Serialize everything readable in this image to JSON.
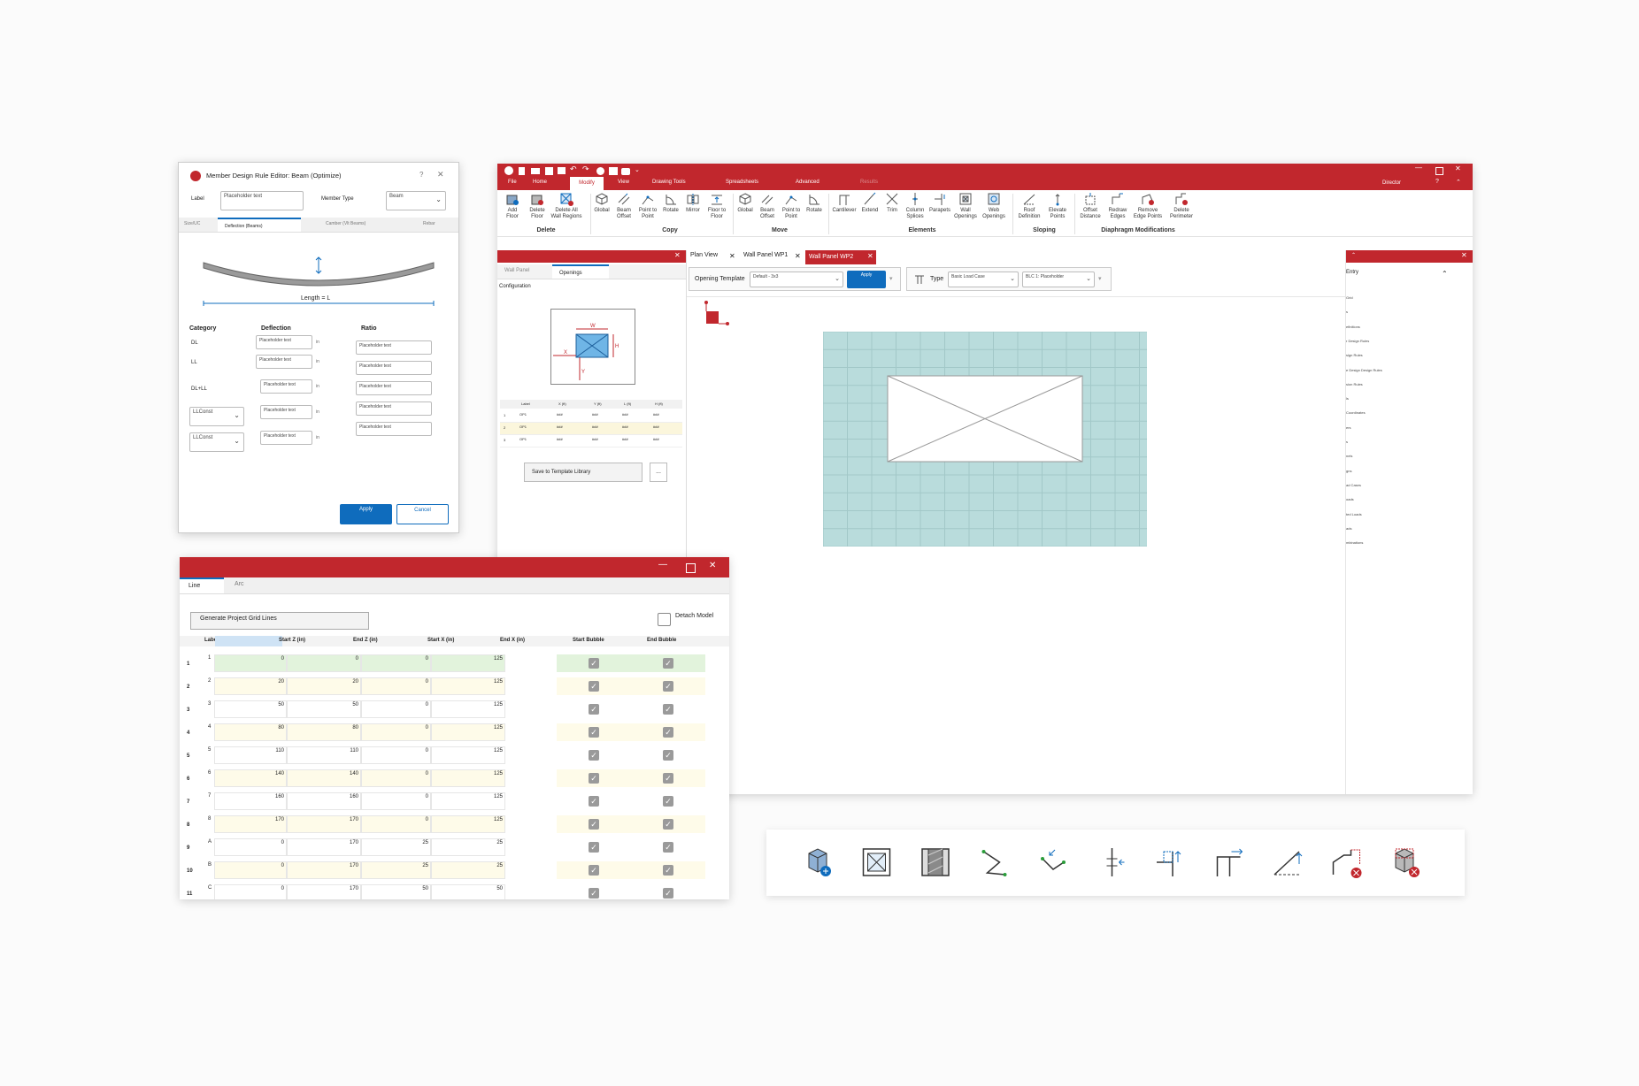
{
  "rule_editor": {
    "title": "Member Design Rule Editor: Beam (Optimize)",
    "help": "?",
    "close": "✕",
    "label_caption": "Label",
    "label_value": "Placeholder text",
    "member_type_caption": "Member Type",
    "member_type_value": "Beam",
    "tabs": [
      "Size/UC",
      "Deflection (Beams)",
      "Camber (Vlt Beams)",
      "Rebar"
    ],
    "length_label": "Length = L",
    "headers": {
      "category": "Category",
      "deflection": "Deflection",
      "ratio": "Ratio"
    },
    "rows": [
      "DL",
      "LL",
      "DL+LL"
    ],
    "combo_values": [
      "LLConst",
      "LLConst"
    ],
    "placeholder": "Placeholder text",
    "unit": "in",
    "apply": "Apply",
    "cancel": "Cancel"
  },
  "main": {
    "account": "Director",
    "menu": [
      "File",
      "Home",
      "Modify",
      "View",
      "Drawing Tools",
      "Spreadsheets",
      "Advanced",
      "Results"
    ],
    "ribbon": {
      "delete": {
        "label": "Delete",
        "items": [
          "Add\nFloor",
          "Delete\nFloor",
          "Delete All\nWall Regions"
        ]
      },
      "copy": {
        "label": "Copy",
        "items": [
          "Global",
          "Beam\nOffset",
          "Point to\nPoint",
          "Rotate",
          "Mirror",
          "Floor to\nFloor"
        ]
      },
      "move": {
        "label": "Move",
        "items": [
          "Global",
          "Beam\nOffset",
          "Point to\nPoint",
          "Rotate"
        ]
      },
      "elements": {
        "label": "Elements",
        "items": [
          "Cantilever",
          "Extend",
          "Trim",
          "Column\nSplices",
          "Parapets",
          "Wall\nOpenings",
          "Web\nOpenings"
        ]
      },
      "sloping": {
        "label": "Sloping",
        "items": [
          "Roof\nDefinition",
          "Elevate\nPoints"
        ]
      },
      "diaphragm": {
        "label": "Diaphragm Modifications",
        "items": [
          "Offset\nDistance",
          "Redraw\nEdges",
          "Remove\nEdge Points",
          "Delete\nPerimeter"
        ]
      }
    },
    "left_panel": {
      "tabs": [
        "Wall Panel",
        "Openings"
      ],
      "configuration": "Configuration",
      "table_headers": [
        "Label",
        "X (ft)",
        "Y (ft)",
        "L (ft)",
        "H (ft)"
      ],
      "rows": [
        {
          "n": "1",
          "label": "OP1",
          "cells": [
            "###",
            "###",
            "###",
            "###"
          ]
        },
        {
          "n": "2",
          "label": "OP1",
          "cells": [
            "###",
            "###",
            "###",
            "###"
          ]
        },
        {
          "n": "3",
          "label": "OP1",
          "cells": [
            "###",
            "###",
            "###",
            "###"
          ]
        }
      ],
      "save": "Save to Template Library",
      "more": "..."
    },
    "doc_tabs": [
      "Plan View",
      "Wall Panel WP1",
      "Wall Panel WP2"
    ],
    "toolbar": {
      "opening_template": "Opening Template",
      "template_value": "Default - 3x3",
      "apply": "Apply",
      "type": "Type",
      "load_case": "Basic Load Case",
      "blc": "BLC 1: Placeholder"
    },
    "right_panel": {
      "header": "Entry",
      "items": [
        "Grid",
        "s",
        "efinitions",
        "r Design Rules",
        "sign Rules",
        "e Design Design Rules",
        "sion Rules",
        "ls",
        "Coordinates",
        "ers",
        "s",
        "nels",
        "gns",
        "ad Cases",
        "oads",
        "ted Loads",
        "ads",
        "mbinations"
      ]
    }
  },
  "grid_lines": {
    "tabs": [
      "Line",
      "Arc"
    ],
    "generate": "Generate Project Grid Lines",
    "detach": "Detach Model",
    "headers": [
      "Label",
      "Start Z (in)",
      "End Z (in)",
      "Start X (in)",
      "End X (in)",
      "Start Bubble",
      "End Bubble"
    ],
    "rows": [
      {
        "n": "1",
        "label": "1",
        "sz": "0",
        "ez": "0",
        "sx": "0",
        "ex": "125"
      },
      {
        "n": "2",
        "label": "2",
        "sz": "20",
        "ez": "20",
        "sx": "0",
        "ex": "125"
      },
      {
        "n": "3",
        "label": "3",
        "sz": "50",
        "ez": "50",
        "sx": "0",
        "ex": "125"
      },
      {
        "n": "4",
        "label": "4",
        "sz": "80",
        "ez": "80",
        "sx": "0",
        "ex": "125"
      },
      {
        "n": "5",
        "label": "5",
        "sz": "110",
        "ez": "110",
        "sx": "0",
        "ex": "125"
      },
      {
        "n": "6",
        "label": "6",
        "sz": "140",
        "ez": "140",
        "sx": "0",
        "ex": "125"
      },
      {
        "n": "7",
        "label": "7",
        "sz": "160",
        "ez": "160",
        "sx": "0",
        "ex": "125"
      },
      {
        "n": "8",
        "label": "8",
        "sz": "170",
        "ez": "170",
        "sx": "0",
        "ex": "125"
      },
      {
        "n": "9",
        "label": "A",
        "sz": "0",
        "ez": "170",
        "sx": "25",
        "ex": "25"
      },
      {
        "n": "10",
        "label": "B",
        "sz": "0",
        "ez": "170",
        "sx": "25",
        "ex": "25"
      },
      {
        "n": "11",
        "label": "C",
        "sz": "0",
        "ez": "170",
        "sx": "50",
        "ex": "50"
      }
    ]
  },
  "icon_strip": [
    "add-floor-icon",
    "wall-opening-icon",
    "wall-region-icon",
    "polyline-icon",
    "redraw-edges-icon",
    "column-splice-icon",
    "parapet-icon",
    "frame-icon",
    "roof-slope-icon",
    "delete-perimeter-icon",
    "delete-floor-icon"
  ],
  "colors": {
    "accent": "#c1272d",
    "primary": "#0f6cbd",
    "panel": "#b9dcdc"
  }
}
